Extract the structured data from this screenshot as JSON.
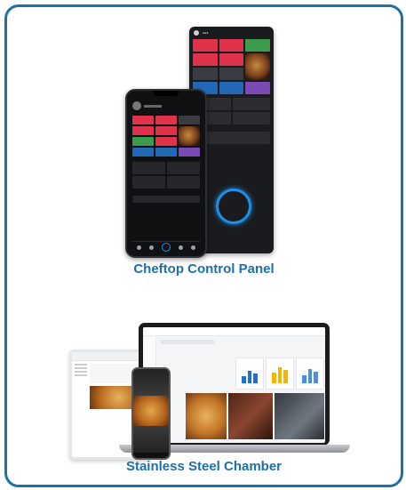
{
  "products": [
    {
      "caption": "Cheftop Control Panel"
    },
    {
      "caption": "Stainless Steel Chamber"
    }
  ],
  "colors": {
    "frame": "#1f6fa8",
    "caption": "#1f6fa8"
  }
}
